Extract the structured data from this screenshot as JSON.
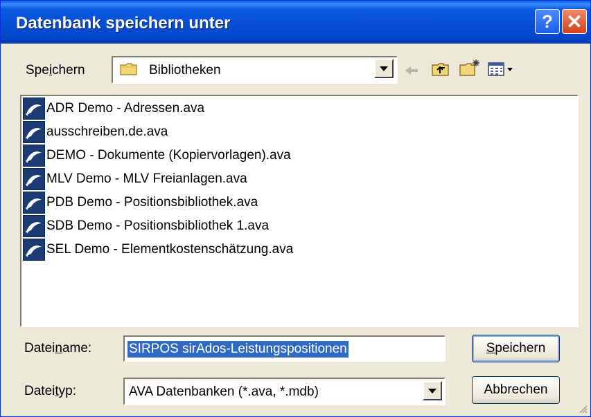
{
  "dialog": {
    "title": "Datenbank speichern unter",
    "help_label": "?",
    "close_label": "✕"
  },
  "save_in": {
    "label_pre": "Spe",
    "label_accel": "i",
    "label_post": "chern",
    "value": "Bibliotheken"
  },
  "toolbar": {
    "icons": [
      "back-arrow-icon",
      "up-folder-icon",
      "new-folder-icon",
      "view-menu-icon"
    ]
  },
  "files": [
    "ADR Demo - Adressen.ava",
    "ausschreiben.de.ava",
    "DEMO - Dokumente (Kopiervorlagen).ava",
    "MLV Demo - MLV Freianlagen.ava",
    "PDB Demo - Positionsbibliothek.ava",
    "SDB Demo - Positionsbibliothek 1.ava",
    "SEL Demo - Elementkostenschätzung.ava"
  ],
  "filename": {
    "label_pre": "Datei",
    "label_accel": "n",
    "label_post": "ame:",
    "value": "SIRPOS sirAdos-Leistungspositionen"
  },
  "filetype": {
    "label_pre": "Datei",
    "label_accel": "t",
    "label_post": "yp:",
    "value": "AVA Datenbanken (*.ava, *.mdb)"
  },
  "buttons": {
    "save_accel": "S",
    "save_rest": "peichern",
    "cancel": "Abbrechen"
  },
  "colors": {
    "titlebar": "#0a5be0",
    "selection": "#316ac5",
    "dialog_bg": "#ece9d8"
  }
}
